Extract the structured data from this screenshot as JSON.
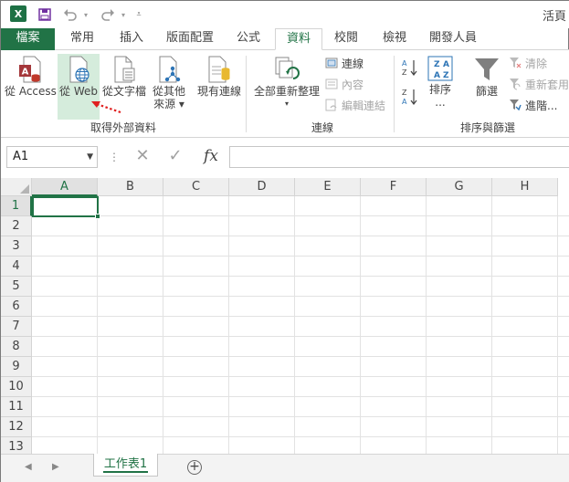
{
  "title_bar": {
    "app_badge": "X",
    "window_title": "活頁"
  },
  "tabs": [
    {
      "label": "檔案"
    },
    {
      "label": "常用"
    },
    {
      "label": "插入"
    },
    {
      "label": "版面配置"
    },
    {
      "label": "公式"
    },
    {
      "label": "資料"
    },
    {
      "label": "校閱"
    },
    {
      "label": "檢視"
    },
    {
      "label": "開發人員"
    }
  ],
  "active_tab": "資料",
  "ribbon": {
    "get_external": {
      "group_label": "取得外部資料",
      "from_access": "從 Access",
      "from_web": "從 Web",
      "from_text": "從文字檔",
      "from_other_line1": "從其他",
      "from_other_line2": "來源",
      "existing": "現有連線"
    },
    "connections": {
      "group_label": "連線",
      "refresh_all": "全部重新整理",
      "connections": "連線",
      "properties": "內容",
      "edit_links": "編輯連結"
    },
    "sort_filter": {
      "group_label": "排序與篩選",
      "sort": "排序",
      "sort_sub": "...",
      "filter": "篩選",
      "clear": "清除",
      "reapply": "重新套用",
      "advanced": "進階..."
    }
  },
  "formula_bar": {
    "name_box": "A1",
    "fx": "fx",
    "value": ""
  },
  "columns": [
    "A",
    "B",
    "C",
    "D",
    "E",
    "F",
    "G",
    "H"
  ],
  "rows": [
    "1",
    "2",
    "3",
    "4",
    "5",
    "6",
    "7",
    "8",
    "9",
    "10",
    "11",
    "12",
    "13"
  ],
  "sheet_tabs": {
    "sheet1": "工作表1"
  },
  "colors": {
    "excel_green": "#217346",
    "highlight": "#d5ecdc",
    "annotation_red": "#e02020"
  }
}
